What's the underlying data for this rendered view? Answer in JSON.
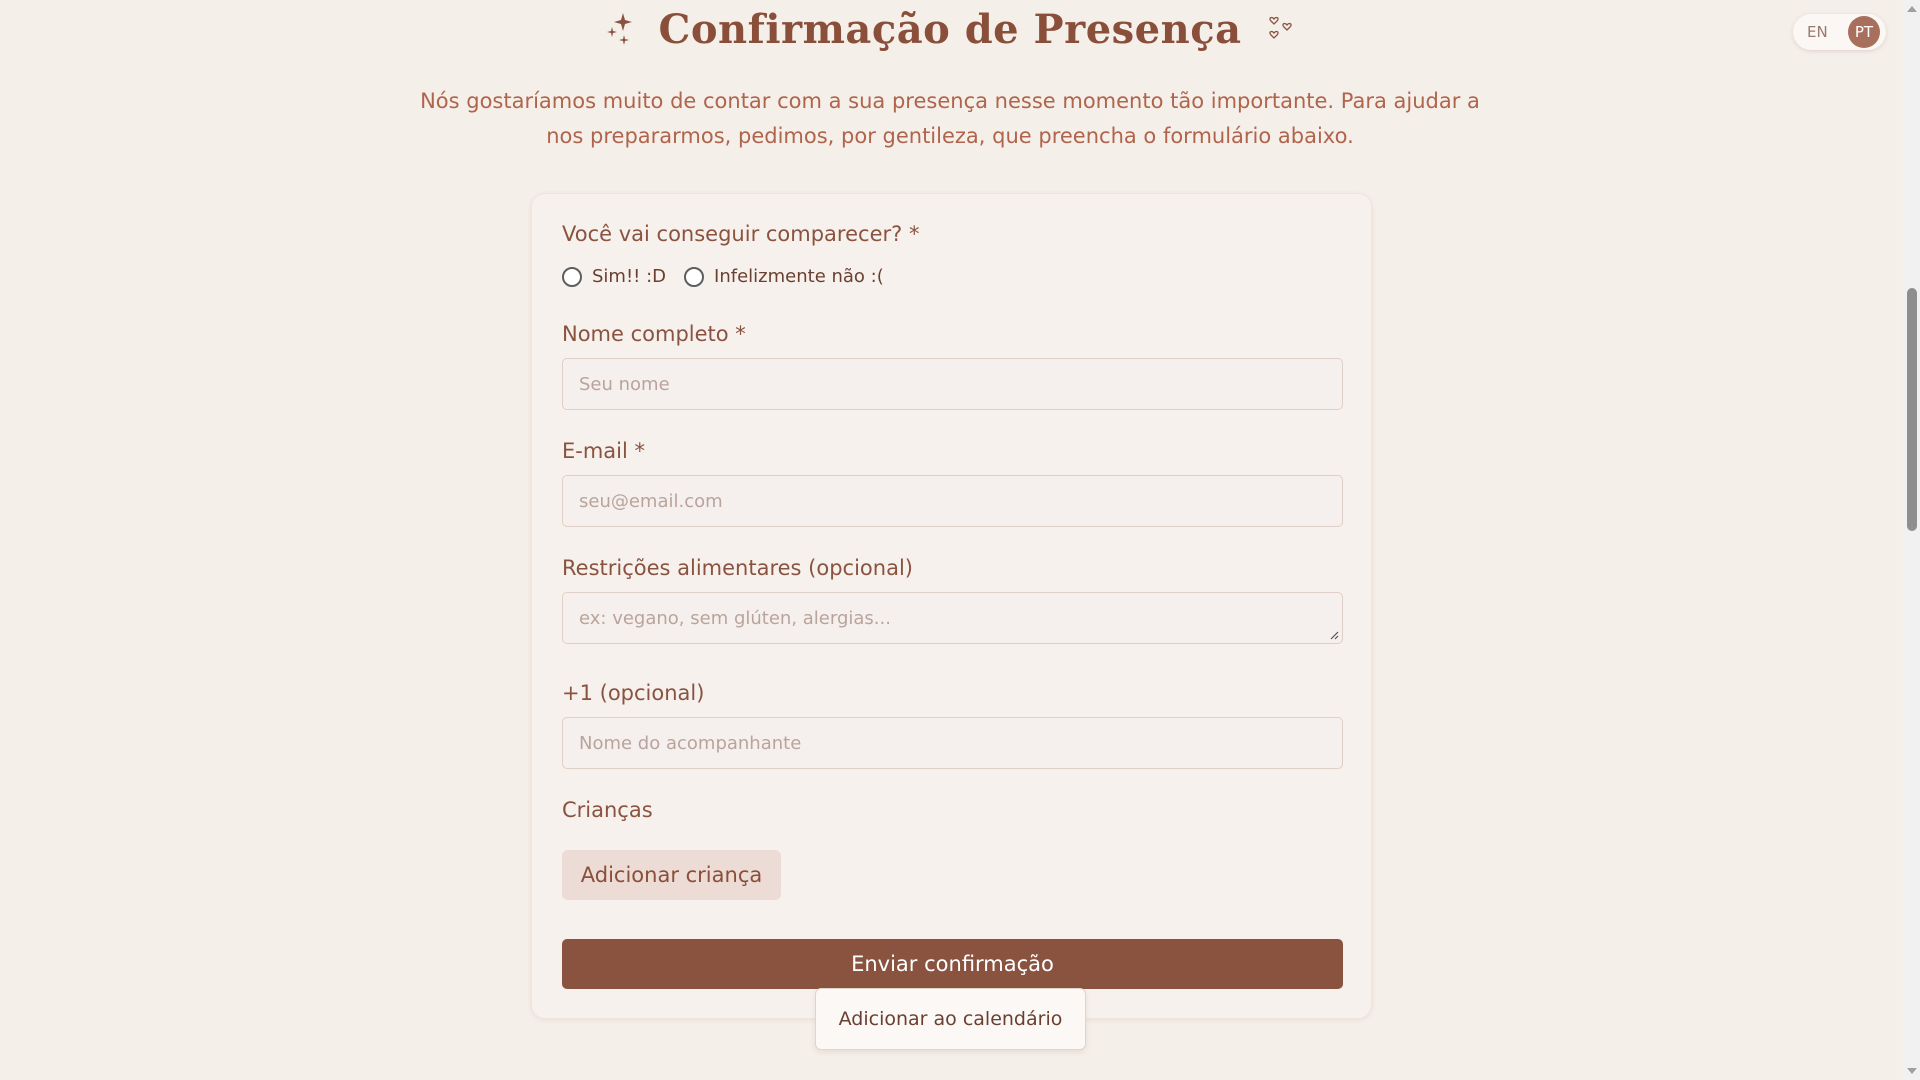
{
  "header": {
    "title": "Confirmação de Presença",
    "intro": "Nós gostaríamos muito de contar com a sua presença nesse momento tão importante. Para ajudar a nos prepararmos, pedimos, por gentileza, que preencha o formulário abaixo."
  },
  "language": {
    "en": "EN",
    "pt": "PT",
    "active": "PT"
  },
  "form": {
    "attendance": {
      "label": "Você vai conseguir comparecer? *",
      "options": [
        "Sim!! :D",
        "Infelizmente não :("
      ]
    },
    "name": {
      "label": "Nome completo *",
      "placeholder": "Seu nome"
    },
    "email": {
      "label": "E-mail *",
      "placeholder": "seu@email.com"
    },
    "dietary": {
      "label": "Restrições alimentares (opcional)",
      "placeholder": "ex: vegano, sem glúten, alergias..."
    },
    "plus_one": {
      "label": "+1 (opcional)",
      "placeholder": "Nome do acompanhante"
    },
    "children": {
      "label": "Crianças",
      "add_button": "Adicionar criança"
    },
    "submit_label": "Enviar confirmação"
  },
  "calendar_button": "Adicionar ao calendário",
  "colors": {
    "accent": "#8a5340",
    "background": "#f5efe9",
    "text": "#b0644c"
  },
  "icons": [
    "sparkle-icon",
    "hearts-icon",
    "resize-handle-icon",
    "scroll-up-icon",
    "scroll-down-icon"
  ]
}
